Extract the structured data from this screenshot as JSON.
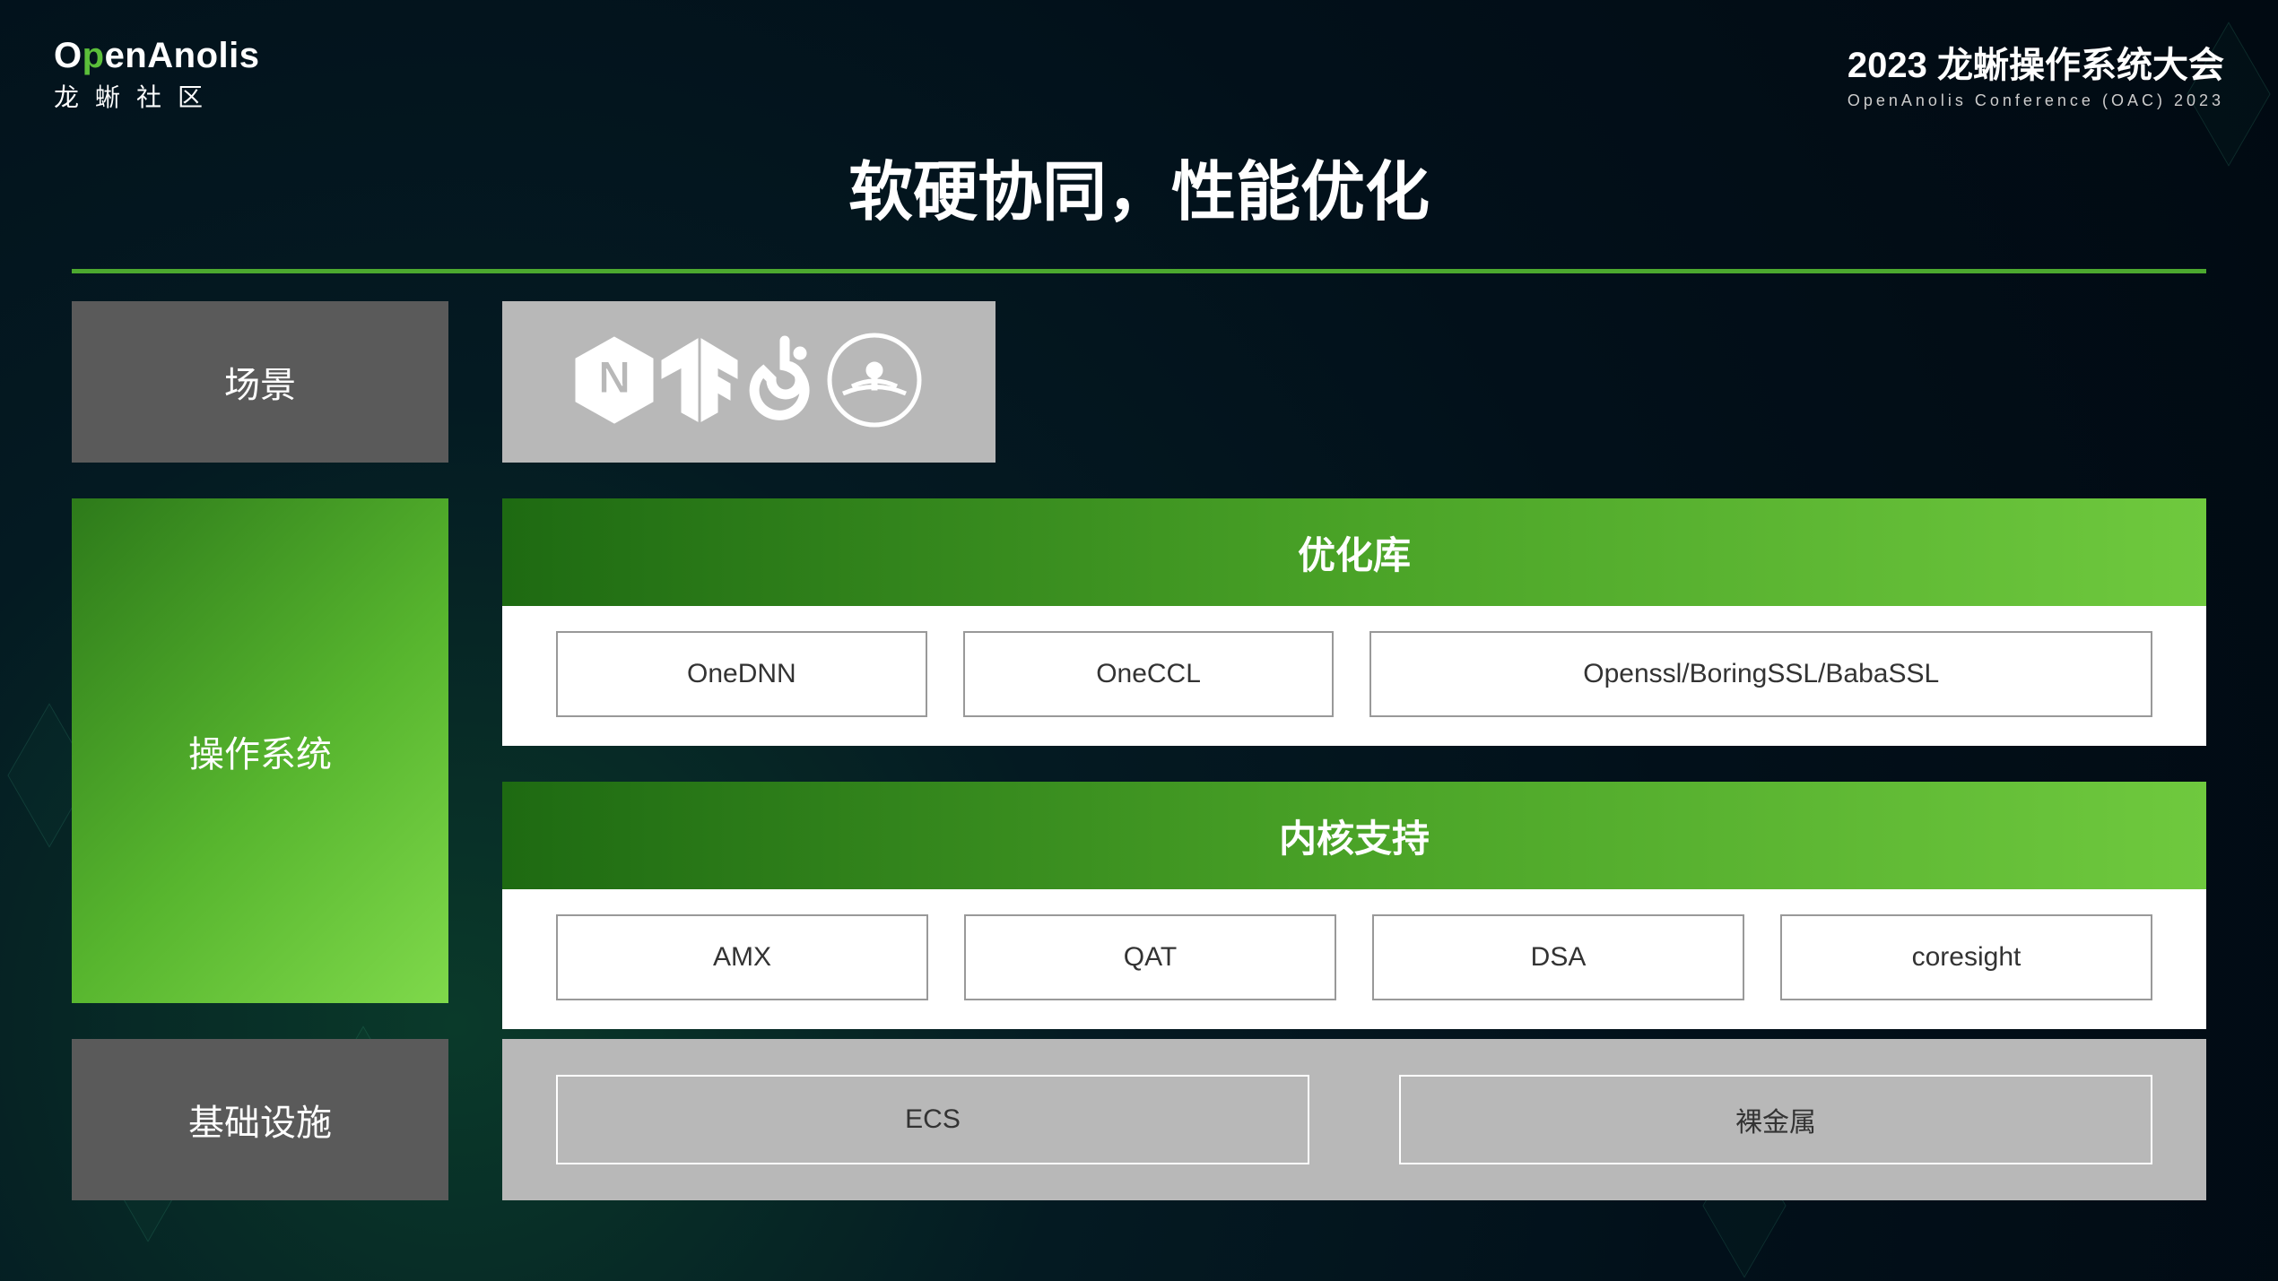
{
  "logo_left": {
    "en_pre": "O",
    "en_accent": "p",
    "en_post": "enAnolis",
    "cn": "龙蜥社区"
  },
  "logo_right": {
    "main": "2023 龙蜥操作系统大会",
    "sub": "OpenAnolis Conference (OAC) 2023"
  },
  "title": "软硬协同，性能优化",
  "rows": {
    "scene_label": "场景",
    "os_label": "操作系统",
    "infra_label": "基础设施"
  },
  "icons": [
    "nginx",
    "tensorflow",
    "pytorch",
    "network"
  ],
  "opt_lib": {
    "header": "优化库",
    "items": [
      "OneDNN",
      "OneCCL",
      "Openssl/BoringSSL/BabaSSL"
    ]
  },
  "kernel": {
    "header": "内核支持",
    "items": [
      "AMX",
      "QAT",
      "DSA",
      "coresight"
    ]
  },
  "infra": {
    "items": [
      "ECS",
      "裸金属"
    ]
  }
}
